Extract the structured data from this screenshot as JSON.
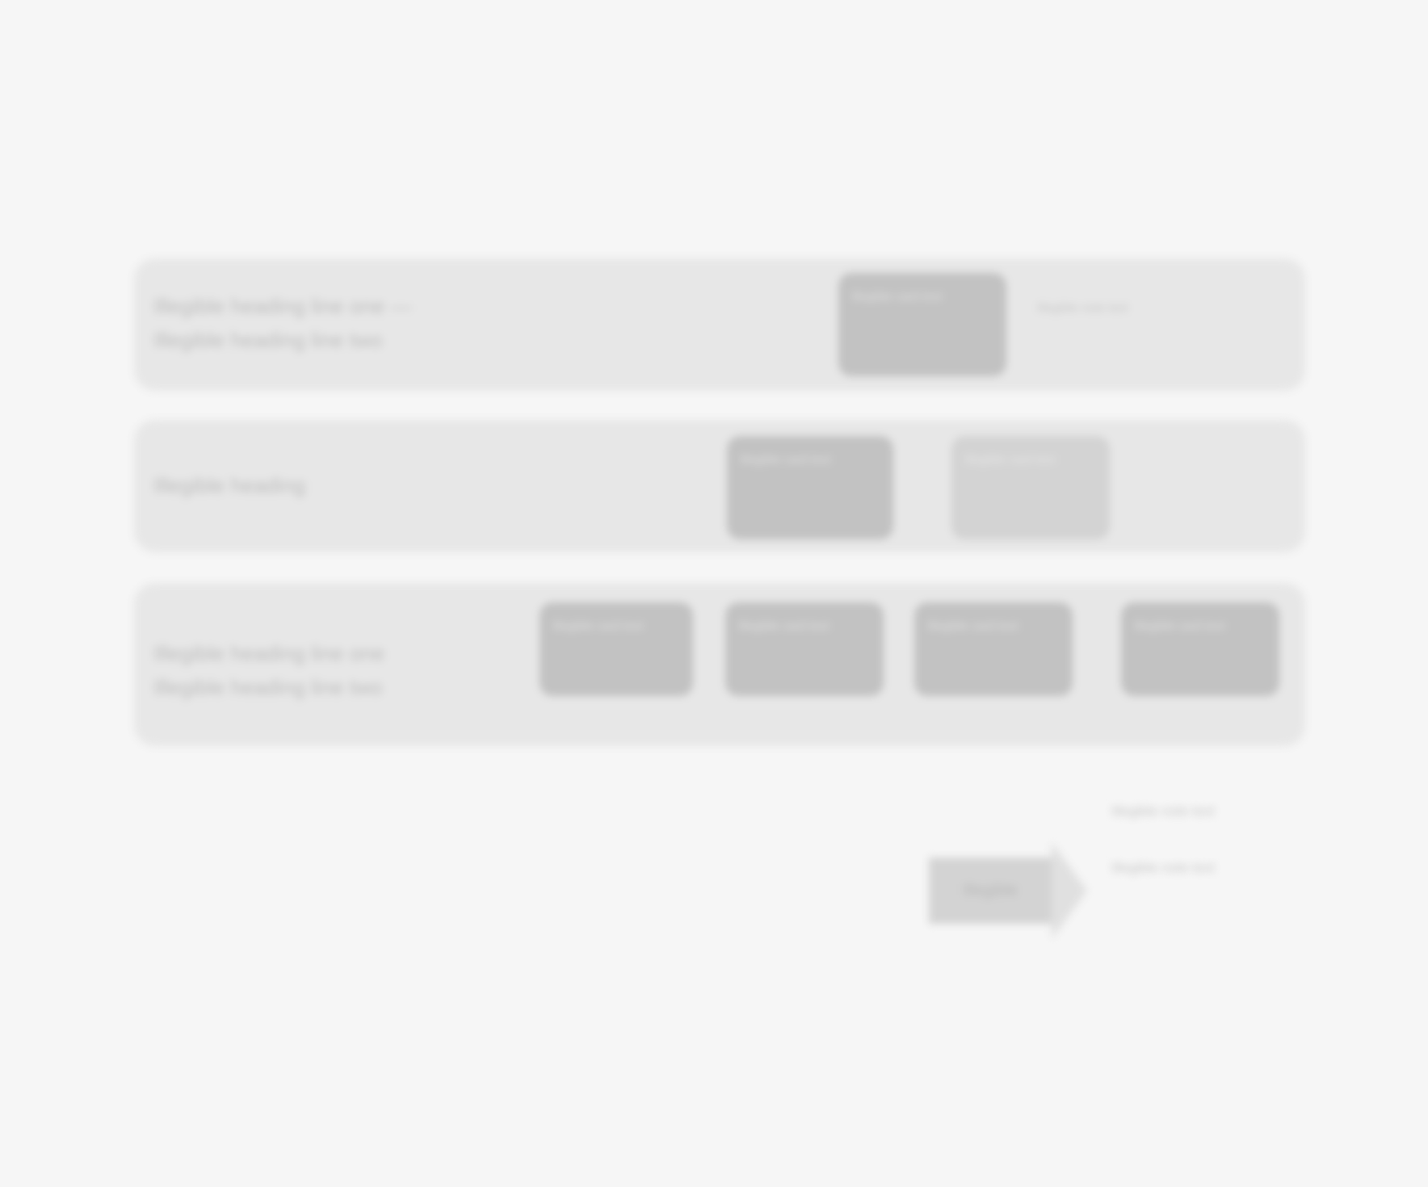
{
  "bands": [
    {
      "label": "Illegible heading line one —\nIllegible heading line two",
      "cards": [
        "Illegible card text"
      ],
      "side_note": "Illegible note text"
    },
    {
      "label": "Illegible heading",
      "cards": [
        "Illegible card text",
        "Illegible card text"
      ]
    },
    {
      "label": "Illegible heading line one\nIllegible heading line two",
      "cards": [
        "Illegible card text",
        "Illegible card text",
        "Illegible card text",
        "Illegible card text"
      ]
    }
  ],
  "arrow": {
    "label": "Illegible"
  },
  "notes": {
    "top": "Illegible note text",
    "bottom": "Illegible note text"
  },
  "colors": {
    "background": "#f6f6f6",
    "band": "#e7e7e7",
    "card_dark": "#c2c2c2",
    "card_light": "#d3d3d3"
  }
}
